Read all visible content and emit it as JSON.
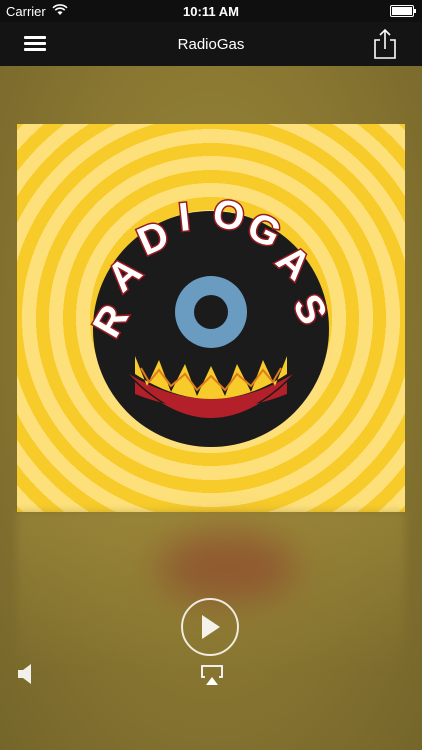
{
  "status_bar": {
    "carrier": "Carrier",
    "time": "10:11 AM",
    "icons": [
      "wifi-icon",
      "battery-icon"
    ]
  },
  "nav": {
    "title": "RadioGas",
    "left_icon": "menu-icon",
    "right_icon": "share-icon"
  },
  "artwork": {
    "logo_text": "RADIOGAS",
    "colors": {
      "ring_dark": "#f6cb2a",
      "ring_light": "#fde07a",
      "disc": "#1b1b1b",
      "eye": "#6a9cc2",
      "mouth": "#b3202a",
      "letter_border": "#9b1b24"
    }
  },
  "player": {
    "play_icon": "play-icon",
    "airplay_icon": "airplay-icon",
    "volume_icon": "speaker-icon"
  },
  "colors": {
    "status_bar": "#0f0f0f",
    "nav_bar": "#141414",
    "background": "#8a7832"
  }
}
